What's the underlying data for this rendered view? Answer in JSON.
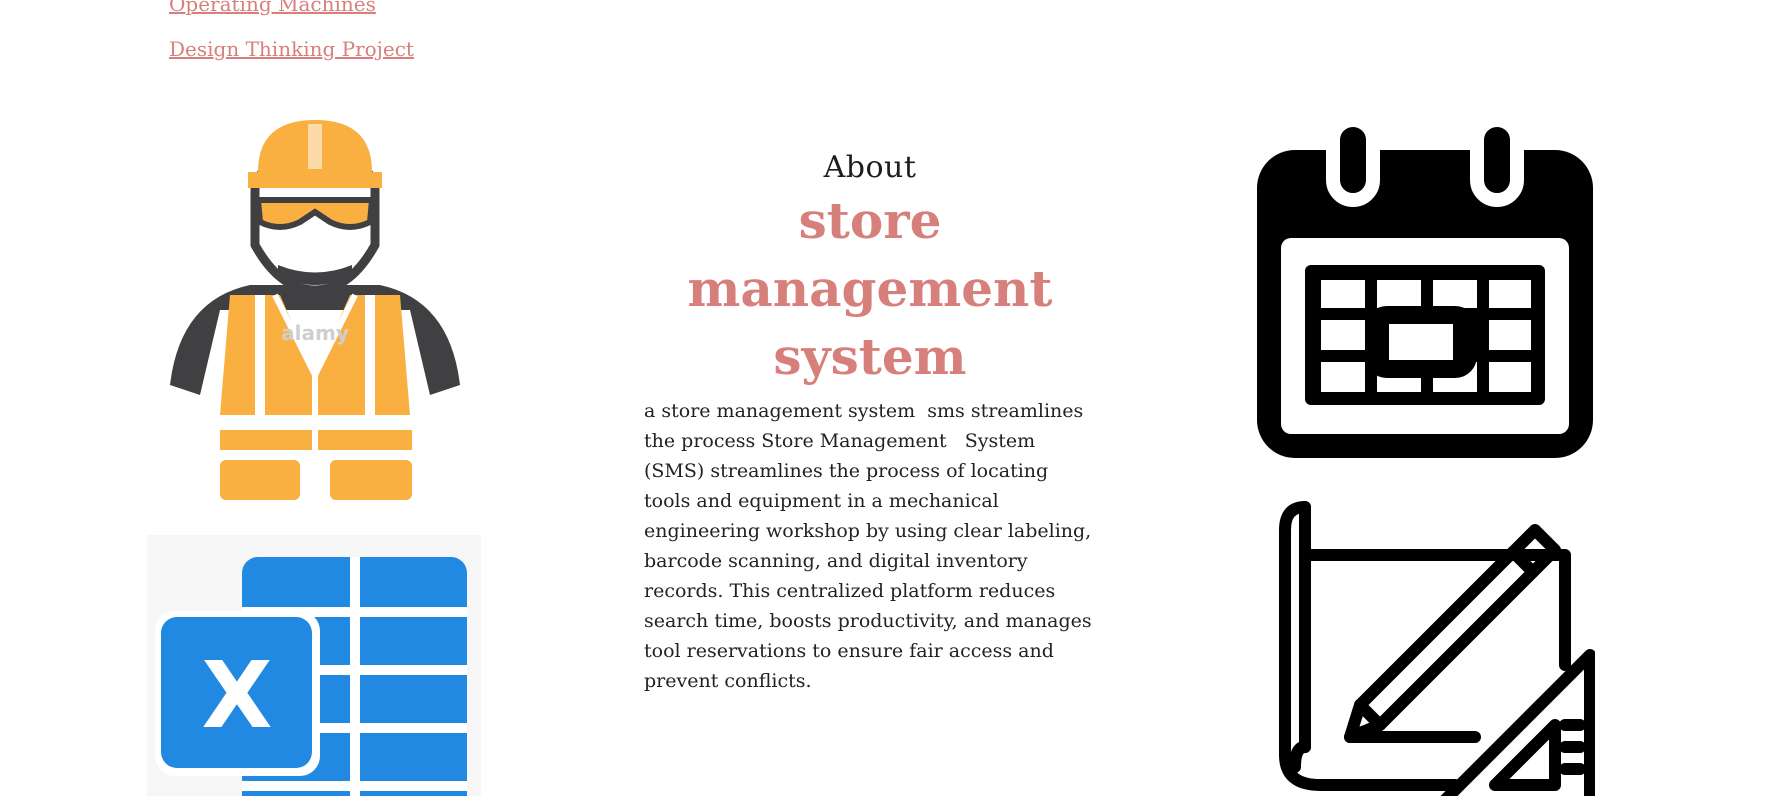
{
  "nav": {
    "links": [
      {
        "label": "Operating Machines"
      },
      {
        "label": "Design Thinking Project"
      }
    ]
  },
  "about": {
    "heading": "About",
    "title": "store management system",
    "description": "a store management system  sms streamlines the process Store Management   System (SMS) streamlines the process of locating tools and equipment in a mechanical engineering workshop by using clear labeling, barcode scanning, and digital inventory records. This centralized platform reduces search time, boosts productivity, and manages tool reservations to ensure fair access and  prevent conflicts."
  },
  "images": {
    "worker": {
      "icon": "construction-worker-icon",
      "watermark": "alamy"
    },
    "excel": {
      "icon": "excel-icon",
      "letter": "X"
    },
    "calendar": {
      "icon": "calendar-icon"
    },
    "blueprint": {
      "icon": "blueprint-pencil-icon"
    }
  },
  "colors": {
    "accent": "#d77f7b",
    "text": "#222222",
    "worker_orange": "#f9b041",
    "worker_gray": "#404043",
    "excel_blue": "#2289e3"
  }
}
